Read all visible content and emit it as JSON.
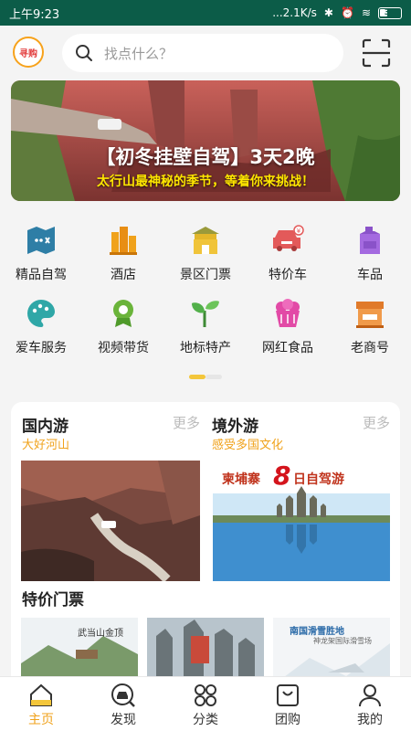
{
  "status": {
    "time": "上午9:23",
    "net_speed": "...2.1K/s",
    "battery": "34"
  },
  "header": {
    "logo_text": "寻购",
    "search_placeholder": "找点什么？"
  },
  "banner": {
    "title": "【初冬挂壁自驾】3天2晚",
    "subtitle": "太行山最神秘的季节，等着你来挑战！"
  },
  "categories": [
    {
      "label": "精品自驾",
      "icon": "road-map-icon",
      "color": "#2e7ea6"
    },
    {
      "label": "酒店",
      "icon": "hotel-icon",
      "color": "#f0a21b"
    },
    {
      "label": "景区门票",
      "icon": "gate-icon",
      "color": "#e3b72a"
    },
    {
      "label": "特价车",
      "icon": "car-icon",
      "color": "#e35a5a"
    },
    {
      "label": "车品",
      "icon": "oil-can-icon",
      "color": "#8a52c9"
    },
    {
      "label": "爱车服务",
      "icon": "palette-icon",
      "color": "#2fa7a7"
    },
    {
      "label": "视频带货",
      "icon": "medal-icon",
      "color": "#6ab43a"
    },
    {
      "label": "地标特产",
      "icon": "sprout-icon",
      "color": "#52b04a"
    },
    {
      "label": "网红食品",
      "icon": "cake-icon",
      "color": "#e24aa6"
    },
    {
      "label": "老商号",
      "icon": "shop-icon",
      "color": "#e07a2a"
    }
  ],
  "sections": {
    "domestic": {
      "title": "国内游",
      "subtitle": "大好河山",
      "more": "更多"
    },
    "overseas": {
      "title": "境外游",
      "subtitle": "感受多国文化",
      "more": "更多",
      "poster_title": "柬埔寨",
      "poster_big": "8",
      "poster_tail": "日自驾游"
    },
    "tickets": {
      "title": "特价门票",
      "items": [
        {
          "caption": "武当山金顶"
        },
        {
          "caption": ""
        },
        {
          "caption": "南国滑雪胜地",
          "caption2": "神龙架国际滑雪场"
        }
      ]
    }
  },
  "tabs": [
    {
      "label": "主页",
      "icon": "home-icon",
      "active": true
    },
    {
      "label": "发现",
      "icon": "discover-car-icon",
      "active": false
    },
    {
      "label": "分类",
      "icon": "category-icon",
      "active": false
    },
    {
      "label": "团购",
      "icon": "group-buy-icon",
      "active": false
    },
    {
      "label": "我的",
      "icon": "user-icon",
      "active": false
    }
  ]
}
